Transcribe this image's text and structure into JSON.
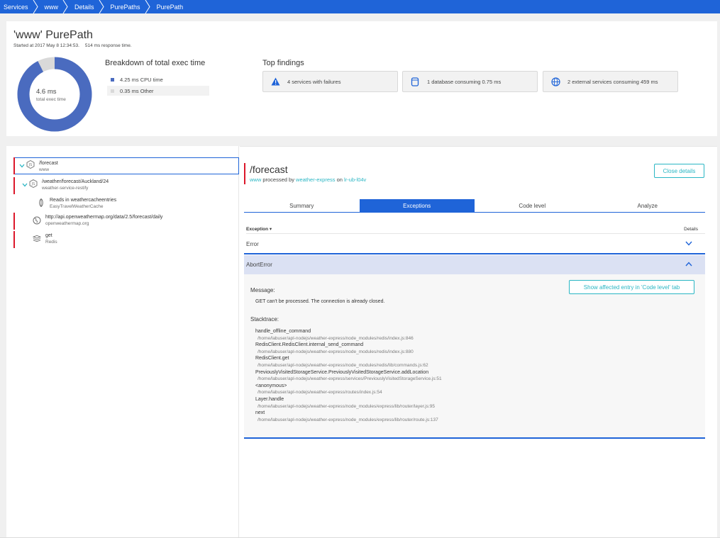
{
  "breadcrumb": [
    "Services",
    "www",
    "Details",
    "PurePaths",
    "PurePath"
  ],
  "header": {
    "title": "'www' PurePath",
    "started": "Started at 2017 May 8 12:34:53.",
    "response": "514 ms response time.",
    "total_exec_value": "4.6 ms",
    "total_exec_label": "total exec time",
    "breakdown_title": "Breakdown of total exec time",
    "breakdown": [
      {
        "label": "4.25 ms CPU time",
        "value_ms": 4.25,
        "color": "#4a6bbf"
      },
      {
        "label": "0.35 ms Other",
        "value_ms": 0.35,
        "color": "#d9d9d9"
      }
    ],
    "top_findings_title": "Top findings",
    "findings": [
      {
        "icon": "warning-icon",
        "label": "4 services with failures"
      },
      {
        "icon": "database-icon",
        "label": "1 database consuming 0.75 ms"
      },
      {
        "icon": "globe-icon",
        "label": "2 external services consuming 459 ms"
      }
    ]
  },
  "tree": [
    {
      "title": "/forecast",
      "sub": "www",
      "icon": "nodejs-icon"
    },
    {
      "title": "/weather/forecast/Auckland/24",
      "sub": "weather-service-restify",
      "icon": "nodejs-icon"
    },
    {
      "title": "Reads in weathercacheentries",
      "sub": "EasyTravelWeatherCache",
      "icon": "mongodb-icon"
    },
    {
      "title": "http://api.openweathermap.org/data/2.5/forecast/daily",
      "sub": "openweathermap.org",
      "icon": "globe-icon"
    },
    {
      "title": "get",
      "sub": "Redis",
      "icon": "redis-icon"
    }
  ],
  "detail": {
    "title": "/forecast",
    "sub_service": "www",
    "sub_processed": "processed by",
    "sub_process": "weather-express",
    "sub_on": "on",
    "sub_host": "lr-ub-l04v",
    "close_label": "Close details",
    "tabs": [
      "Summary",
      "Exceptions",
      "Code level",
      "Analyze"
    ],
    "active_tab": "Exceptions",
    "exception_col": "Exception ▾",
    "details_col": "Details",
    "exceptions": [
      "Error",
      "AbortError"
    ],
    "message_label": "Message:",
    "message": "GET can't be processed. The connection is already closed.",
    "affected_btn": "Show affected entry in 'Code level' tab",
    "stacktrace_label": "Stacktrace:",
    "frames": [
      {
        "fn": "handle_offline_command",
        "path": "/home/labuser/apl-nodejs/weather-express/node_modules/redis/index.js:846"
      },
      {
        "fn": "RedisClient.RedisClient.internal_send_command",
        "path": "/home/labuser/apl-nodejs/weather-express/node_modules/redis/index.js:880"
      },
      {
        "fn": "RedisClient.get",
        "path": "/home/labuser/apl-nodejs/weather-express/node_modules/redis/lib/commands.js:62"
      },
      {
        "fn": "PreviouslyVisitedStorageService.PreviouslyVisitedStorageService.addLocation",
        "path": "/home/labuser/apl-nodejs/weather-express/services/PreviouslyVisitedStorageService.js:51"
      },
      {
        "fn": "<anonymous>",
        "path": "/home/labuser/apl-nodejs/weather-express/routes/index.js:54"
      },
      {
        "fn": "Layer.handle",
        "path": "/home/labuser/apl-nodejs/weather-express/node_modules/express/lib/router/layer.js:95"
      },
      {
        "fn": "next",
        "path": "/home/labuser/apl-nodejs/weather-express/node_modules/express/lib/router/route.js:137"
      }
    ]
  },
  "colors": {
    "brand_blue": "#1f64d8",
    "accent_teal": "#2ab6c4",
    "failure_red": "#dc172a"
  }
}
